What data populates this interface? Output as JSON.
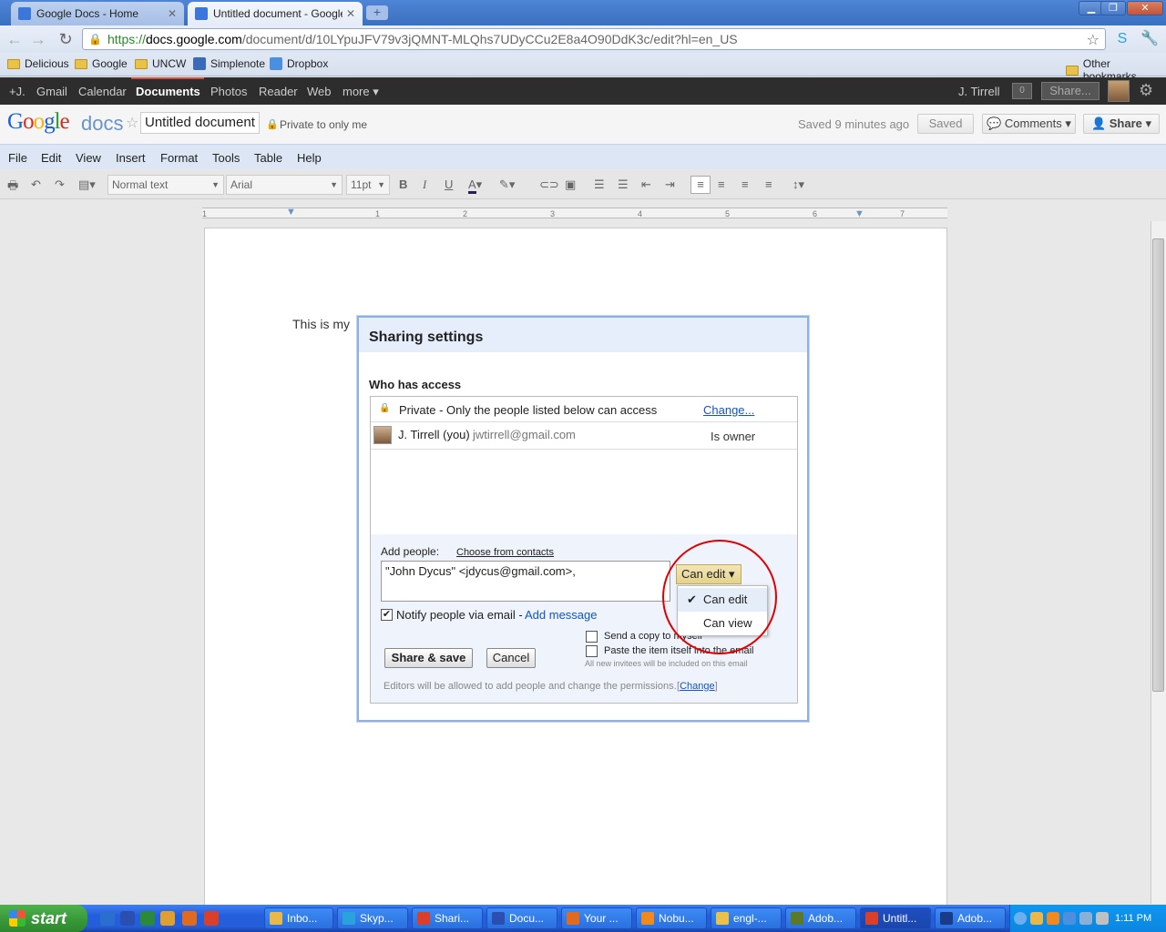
{
  "browser": {
    "tabs": [
      {
        "title": "Google Docs - Home",
        "active": false
      },
      {
        "title": "Untitled document - Google Do",
        "active": true
      }
    ],
    "url": {
      "scheme": "https://",
      "host": "docs.google.com",
      "path": "/document/d/10LYpuJFV79v3jQMNT-MLQhs7UDyCCu2E8a4O90DdK3c/edit?hl=en_US"
    },
    "bookmarks": [
      "Delicious",
      "Google",
      "UNCW",
      "Simplenote",
      "Dropbox"
    ],
    "other_bookmarks": "Other bookmarks"
  },
  "gbar": {
    "items": [
      "+J.",
      "Gmail",
      "Calendar",
      "Documents",
      "Photos",
      "Reader",
      "Web",
      "more ▾"
    ],
    "user": "J. Tirrell",
    "count": "0",
    "share": "Share..."
  },
  "docs": {
    "logo_word": "Google",
    "logo_docs": "docs",
    "title": "Untitled document",
    "privacy": "Private to only me",
    "saved_status": "Saved 9 minutes ago",
    "saved_btn": "Saved",
    "comments_btn": "Comments ▾",
    "share_btn": "Share",
    "menus": [
      "File",
      "Edit",
      "View",
      "Insert",
      "Format",
      "Tools",
      "Table",
      "Help"
    ],
    "style_select": "Normal text",
    "font_select": "Arial",
    "size_select": "11pt",
    "ruler_numbers": [
      "1",
      "1",
      "2",
      "3",
      "4",
      "5",
      "6",
      "7"
    ],
    "body_text": "This is my"
  },
  "dialog": {
    "title": "Sharing settings",
    "who_label": "Who has access",
    "private_text": "Private - Only the people listed below can access",
    "change_link": "Change...",
    "owner_name": "J. Tirrell (you)",
    "owner_email": "jwtirrell@gmail.com",
    "owner_role": "Is owner",
    "add_people_label": "Add people:",
    "choose_contacts": "Choose from contacts",
    "invite_value": "\"John Dycus\" <jdycus@gmail.com>,",
    "perm_selected": "Can edit",
    "perm_options": [
      "Can edit",
      "Can view"
    ],
    "notify_label": "Notify people via email -",
    "add_message": "Add message",
    "send_copy": "Send a copy to myself",
    "paste_item": "Paste the item itself into the email",
    "invitees_note": "All new invitees will be included on this email",
    "share_save_btn": "Share & save",
    "cancel_btn": "Cancel",
    "editors_note": "Editors will be allowed to add people and change the permissions.",
    "editors_change": "Change"
  },
  "taskbar": {
    "start": "start",
    "tasks": [
      "Inbo...",
      "Skyp...",
      "Shari...",
      "Docu...",
      "Your ...",
      "Nobu...",
      "engl-...",
      "Adob...",
      "Untitl...",
      "Adob..."
    ],
    "clock": "1:11 PM"
  }
}
